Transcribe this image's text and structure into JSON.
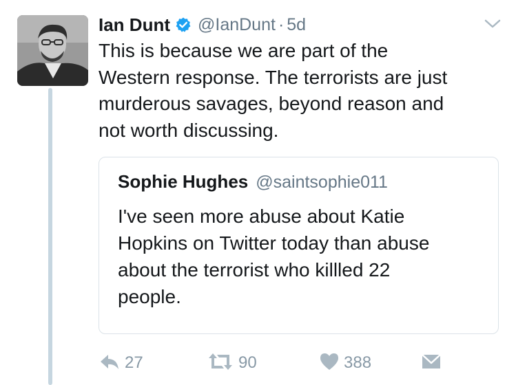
{
  "tweet": {
    "author_name": "Ian Dunt",
    "handle": "@IanDunt",
    "separator": "·",
    "time": "5d",
    "text": "This is because we are part of the\nWestern response. The terrorists are just\nmurderous savages, beyond reason and\nnot worth discussing.",
    "avatar_icon": "profile-photo",
    "verified_icon": "verified-badge-icon",
    "menu_icon": "chevron-down-icon"
  },
  "quoted_tweet": {
    "author_name": "Sophie Hughes",
    "handle": "@saintsophie011",
    "text": "I've seen more abuse about Katie\nHopkins on Twitter today than abuse\nabout the terrorist who killled 22\npeople."
  },
  "actions": {
    "reply_count": "27",
    "retweet_count": "90",
    "like_count": "388",
    "reply_icon": "reply-icon",
    "retweet_icon": "retweet-icon",
    "like_icon": "heart-icon",
    "dm_icon": "envelope-icon"
  },
  "colors": {
    "verified": "#1da1f2",
    "secondary_text": "#657786",
    "action_gray": "#aab8c2",
    "thread_line": "#c6d6e0"
  }
}
